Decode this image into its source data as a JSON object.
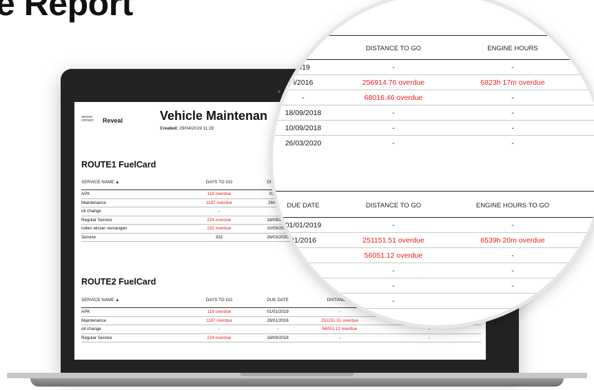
{
  "page_heading": "e Report",
  "report": {
    "logo_small": "verizon\nconnect",
    "logo_brand": "Reveal",
    "title": "Vehicle Maintenan",
    "created_label": "Created:",
    "created_value": "29/04/2019 11:28"
  },
  "sections": [
    {
      "title": "ROUTE1 FuelCard",
      "columns": [
        "SERVICE NAME ▲",
        "DAYS TO GO",
        "DUE DATE"
      ],
      "rows": [
        {
          "name": "APK",
          "days": "118 overdue",
          "days_red": true,
          "due": "01/01/20"
        },
        {
          "name": "Maintenance",
          "days": "1187 overdue",
          "days_red": true,
          "due": "28/01/201"
        },
        {
          "name": "oil change",
          "days": "-",
          "days_red": false,
          "due": "-"
        },
        {
          "name": "Regular Service",
          "days": "224 overdue",
          "days_red": true,
          "due": "18/09/2018"
        },
        {
          "name": "ruiten wisser vervangen",
          "days": "232 overdue",
          "days_red": true,
          "due": "10/09/2018"
        },
        {
          "name": "Service",
          "days": "332",
          "days_red": false,
          "due": "26/03/2020"
        }
      ]
    },
    {
      "title": "ROUTE2 FuelCard",
      "columns": [
        "SERVICE NAME ▲",
        "DAYS TO GO",
        "DUE DATE",
        "DISTANCE T"
      ],
      "rows": [
        {
          "name": "APK",
          "days": "118 overdue",
          "days_red": true,
          "due": "01/01/2019",
          "distance": "-",
          "distance_red": false,
          "hours": "-",
          "hours_red": false
        },
        {
          "name": "Maintenance",
          "days": "1187 overdue",
          "days_red": true,
          "due": "28/01/2016",
          "distance": "251151.51 overdue",
          "distance_red": true,
          "hours": "6539h 20m overdue",
          "hours_red": true
        },
        {
          "name": "oil change",
          "days": "-",
          "days_red": false,
          "due": "-",
          "distance": "56051.12 overdue",
          "distance_red": true,
          "hours": "-",
          "hours_red": false
        },
        {
          "name": "Regular Service",
          "days": "224 overdue",
          "days_red": true,
          "due": "18/09/2018",
          "distance": "-",
          "distance_red": false,
          "hours": "-",
          "hours_red": false
        }
      ]
    }
  ],
  "magnifier": {
    "top_headers": {
      "distance": "DISTANCE TO GO",
      "hours": "ENGINE HOURS"
    },
    "top_rows": [
      {
        "due": "'019",
        "distance": "-",
        "distance_red": false,
        "hours": "-",
        "hours_red": false
      },
      {
        "due": "i/2016",
        "distance": "256914.76 overdue",
        "distance_red": true,
        "hours": "6823h 17m overdue",
        "hours_red": true
      },
      {
        "due": "-",
        "distance": "68016.46 overdue",
        "distance_red": true,
        "hours": "-",
        "hours_red": false
      },
      {
        "due": "18/09/2018",
        "distance": "-",
        "distance_red": false,
        "hours": "-",
        "hours_red": false
      },
      {
        "due": "10/09/2018",
        "distance": "-",
        "distance_red": false,
        "hours": "-",
        "hours_red": false
      },
      {
        "due": "26/03/2020",
        "distance": "-",
        "distance_red": false,
        "hours": "-",
        "hours_red": false
      }
    ],
    "bottom_headers": {
      "due": "DUE DATE",
      "distance": "DISTANCE TO GO",
      "hours": "ENGINE HOURS TO GO"
    },
    "bottom_rows": [
      {
        "due": "01/01/2019",
        "distance": "-",
        "distance_red": false,
        "hours": "-",
        "hours_red": false
      },
      {
        "due": "01/2016",
        "distance": "251151.51 overdue",
        "distance_red": true,
        "hours": "6539h 20m overdue",
        "hours_red": true
      },
      {
        "due": "",
        "distance": "56051.12 overdue",
        "distance_red": true,
        "hours": "-",
        "hours_red": false
      },
      {
        "due": "'8",
        "distance": "-",
        "distance_red": false,
        "hours": "-",
        "hours_red": false
      },
      {
        "due": "",
        "distance": "-",
        "distance_red": false,
        "hours": "-",
        "hours_red": false
      },
      {
        "due": "",
        "distance": "-",
        "distance_red": false,
        "hours": "",
        "hours_red": false
      }
    ]
  },
  "colors": {
    "overdue": "#e02020",
    "bezel": "#232323"
  }
}
